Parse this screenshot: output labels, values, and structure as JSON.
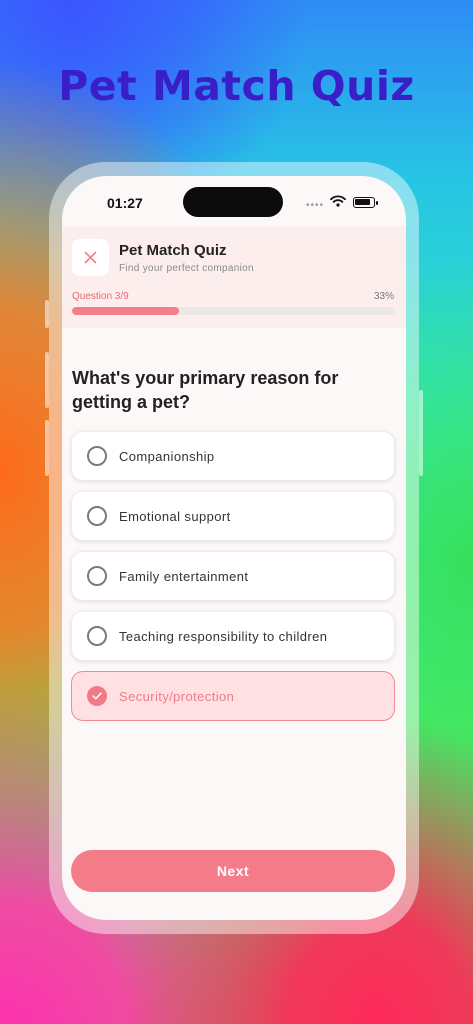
{
  "banner": {
    "title": "Pet Match Quiz"
  },
  "status_bar": {
    "time": "01:27",
    "signal": "••••"
  },
  "header": {
    "title": "Pet Match Quiz",
    "subtitle": "Find your perfect companion",
    "question_counter": "Question 3/9",
    "progress_text": "33%",
    "progress": 0.33
  },
  "question": {
    "text": "What's your primary reason for getting a pet?"
  },
  "options": [
    {
      "label": "Companionship",
      "selected": false
    },
    {
      "label": "Emotional support",
      "selected": false
    },
    {
      "label": "Family entertainment",
      "selected": false
    },
    {
      "label": "Teaching responsibility to children",
      "selected": false
    },
    {
      "label": "Security/protection",
      "selected": true
    }
  ],
  "footer": {
    "next_label": "Next"
  },
  "colors": {
    "accent": "#f47c88",
    "title": "#3a1fc9",
    "selected_bg": "#ffe1e4"
  },
  "icons": {
    "close": "close-icon",
    "check": "check-icon",
    "wifi": "wifi-icon",
    "battery": "battery-icon"
  }
}
